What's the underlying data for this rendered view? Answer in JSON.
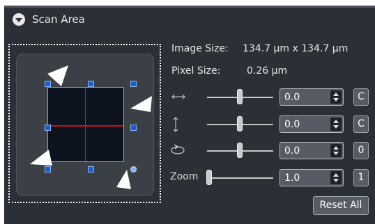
{
  "header": {
    "title": "Scan Area"
  },
  "info": {
    "image_size_label": "Image Size:",
    "image_size_value": "134.7  µm x  134.7  µm",
    "pixel_size_label": "Pixel Size:",
    "pixel_size_value": "0.26 µm"
  },
  "controls": {
    "offset_x": {
      "value": "0.0",
      "button": "C"
    },
    "offset_y": {
      "value": "0.0",
      "button": "C"
    },
    "rotation": {
      "value": "0.0",
      "button": "0"
    },
    "zoom": {
      "label": "Zoom",
      "value": "1.0",
      "button": "1"
    }
  },
  "reset_label": "Reset All",
  "icons": {
    "collapse": "chevron-down-icon",
    "offset_x": "horizontal-arrow-icon",
    "offset_y": "vertical-arrow-icon",
    "rotation": "rotate-icon"
  },
  "colors": {
    "panel_bg": "#2b2f36",
    "scan_field": "#0d1420",
    "center_line": "#c01818",
    "handle": "#1560d8"
  }
}
